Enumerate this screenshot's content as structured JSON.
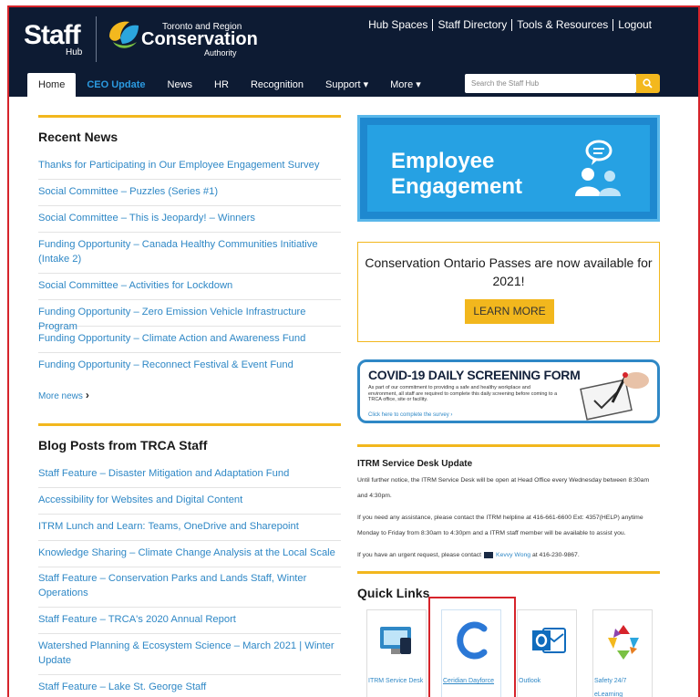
{
  "header": {
    "logo_staff": "Staff",
    "logo_hub": "Hub",
    "org_line1": "Toronto and Region",
    "org_line2": "Conservation",
    "org_line3": "Authority",
    "top_links": [
      "Hub Spaces",
      "Staff Directory",
      "Tools & Resources",
      "Logout"
    ]
  },
  "nav": {
    "items": [
      "Home",
      "CEO Update",
      "News",
      "HR",
      "Recognition",
      "Support ▾",
      "More ▾"
    ]
  },
  "search": {
    "placeholder": "Search the Staff Hub"
  },
  "recent_news": {
    "title": "Recent News",
    "items": [
      "Thanks for Participating in Our Employee Engagement Survey",
      "Social Committee – Puzzles (Series #1)",
      "Social Committee – This is Jeopardy! – Winners",
      "Funding Opportunity – Canada Healthy Communities Initiative (Intake 2)",
      "Social Committee – Activities for Lockdown",
      "Funding Opportunity – Zero Emission Vehicle Infrastructure Program",
      "Funding Opportunity – Climate Action and Awareness Fund",
      "Funding Opportunity – Reconnect Festival & Event Fund"
    ],
    "more": "More news"
  },
  "blog": {
    "title": "Blog Posts from TRCA Staff",
    "items": [
      "Staff Feature – Disaster Mitigation and Adaptation Fund",
      "Accessibility for Websites and Digital Content",
      "ITRM Lunch and Learn: Teams, OneDrive and Sharepoint",
      "Knowledge Sharing – Climate Change Analysis at the Local Scale",
      "Staff Feature – Conservation Parks and Lands Staff, Winter Operations",
      "Staff Feature – TRCA's 2020 Annual Report",
      "Watershed Planning & Ecosystem Science – March 2021 | Winter Update",
      "Staff Feature – Lake St. George Staff"
    ]
  },
  "banners": {
    "ee_line1": "Employee",
    "ee_line2": "Engagement",
    "co_text": "Conservation Ontario Passes are now available for 2021!",
    "co_button": "LEARN MORE",
    "covid_title": "COVID-19 DAILY SCREENING FORM",
    "covid_text": "As part of our commitment to providing a safe and healthy workplace and environment, all staff are required to complete this daily screening before coming to a TRCA office, site or facility.",
    "covid_link": "Click here to complete the survey ›"
  },
  "itrm": {
    "title": "ITRM Service Desk Update",
    "p1": "Until further notice, the ITRM Service Desk will be open at Head Office every Wednesday between 8:30am and 4:30pm.",
    "p2": "If you need any assistance, please contact the ITRM helpline at 416-661-6600 Ext: 4357(HELP) anytime Monday to Friday from 8:30am to 4:30pm and a ITRM staff member will be available to assist you.",
    "p3_pre": "If you have an urgent request, please contact",
    "p3_name": "Kevvy Wong",
    "p3_post": "at 416-230-9867."
  },
  "quick_links": {
    "title": "Quick Links",
    "items": [
      "ITRM Service Desk",
      "Ceridian Dayforce",
      "Outlook",
      "Safety 24/7 eLearning"
    ]
  },
  "colors": {
    "header_bg": "#0d1b33",
    "accent_yellow": "#f2b71d",
    "link_blue": "#2f88c6",
    "highlight_red": "#d6242b"
  }
}
